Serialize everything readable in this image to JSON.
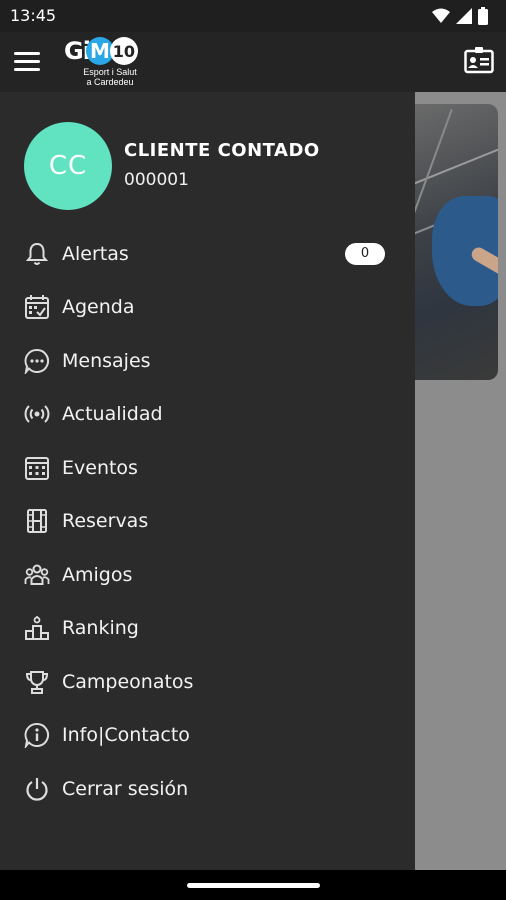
{
  "status_bar": {
    "time": "13:45"
  },
  "app_bar": {
    "logo_text": "GiM10",
    "logo_subtitle_line1": "Esport i Salut",
    "logo_subtitle_line2": "a Cardedeu"
  },
  "profile": {
    "initials": "CC",
    "name": "CLIENTE CONTADO",
    "id": "000001",
    "avatar_color": "#61e3c2"
  },
  "menu": {
    "items": [
      {
        "label": "Alertas",
        "icon": "bell-icon",
        "badge": "0"
      },
      {
        "label": "Agenda",
        "icon": "calendar-check-icon"
      },
      {
        "label": "Mensajes",
        "icon": "chat-bubble-icon"
      },
      {
        "label": "Actualidad",
        "icon": "broadcast-icon"
      },
      {
        "label": "Eventos",
        "icon": "calendar-grid-icon"
      },
      {
        "label": "Reservas",
        "icon": "film-strip-icon"
      },
      {
        "label": "Amigos",
        "icon": "group-icon"
      },
      {
        "label": "Ranking",
        "icon": "podium-icon"
      },
      {
        "label": "Campeonatos",
        "icon": "trophy-icon"
      },
      {
        "label": "Info|Contacto",
        "icon": "info-icon"
      },
      {
        "label": "Cerrar sesión",
        "icon": "power-icon"
      }
    ]
  }
}
